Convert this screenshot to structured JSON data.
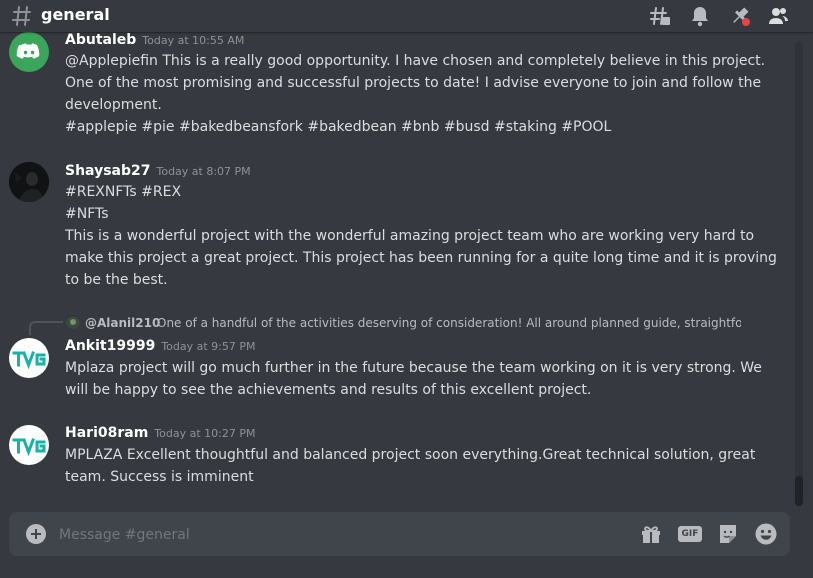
{
  "header": {
    "channel_name": "general",
    "icons": [
      "threads-icon",
      "notification-bell-icon",
      "pin-icon",
      "member-list-icon"
    ]
  },
  "messages": [
    {
      "username": "Abutaleb",
      "timestamp": "Today at 10:55 AM",
      "avatar": "discord-logo",
      "lines": [
        "@Applepiefin This is a really good opportunity. I have chosen and completely believe in this project.",
        "One of the most promising and successful projects to date! I advise everyone to join and follow the",
        "development.",
        "#applepie #pie #bakedbeansfork #bakedbean #bnb #busd #staking #POOL"
      ]
    },
    {
      "username": "Shaysab27",
      "timestamp": "Today at 8:07 PM",
      "avatar": "dark-photo",
      "lines": [
        "#REXNFTs #REX",
        "#NFTs",
        "This is a wonderful project with the wonderful amazing project team who are working very hard to",
        "make this project a great project. This project has been running for a quite long time and it is proving",
        "to be the best."
      ]
    },
    {
      "username": "Ankit19999",
      "timestamp": "Today at 9:57 PM",
      "avatar": "tvg-logo",
      "reply": {
        "username": "@Alanil210",
        "text": "One of a handful of the activities deserving of consideration! All around planned guide, straightforw..."
      },
      "lines": [
        "Mplaza project will go much further in the future because the team working on it is very strong. We",
        "will be happy to see the achievements and results of this excellent project."
      ]
    },
    {
      "username": "Hari08ram",
      "timestamp": "Today at 10:27 PM",
      "avatar": "tvg-logo",
      "lines": [
        "MPLAZA Excellent thoughtful and balanced project soon everything.Great technical solution, great",
        "team. Success is imminent"
      ]
    }
  ],
  "composer": {
    "placeholder": "Message #general",
    "value": "",
    "gif_label": "GIF",
    "icons": [
      "add-attachment-icon",
      "gift-icon",
      "gif-icon",
      "sticker-icon",
      "emoji-icon"
    ]
  },
  "colors": {
    "background": "#36393f",
    "input_bg": "#40444b",
    "text": "#dcddde",
    "username": "#ffffff",
    "timestamp": "#8e9297",
    "discord_green": "#3ba55c",
    "tvg_teal": "#13b3a8",
    "notification_red": "#ed4245"
  }
}
